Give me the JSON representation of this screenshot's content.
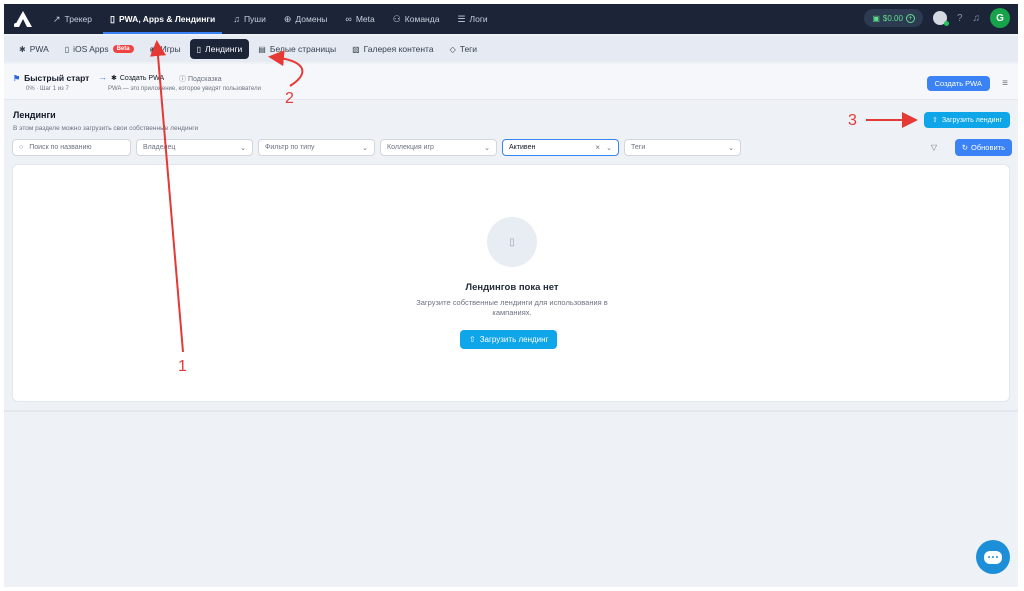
{
  "topnav": {
    "items": [
      {
        "label": "Трекер",
        "icon": "chart-icon"
      },
      {
        "label": "PWA, Apps & Лендинги",
        "icon": "phone-icon",
        "active": true
      },
      {
        "label": "Пуши",
        "icon": "bell-icon"
      },
      {
        "label": "Домены",
        "icon": "globe-icon"
      },
      {
        "label": "Meta",
        "icon": "meta-icon"
      },
      {
        "label": "Команда",
        "icon": "team-icon"
      },
      {
        "label": "Логи",
        "icon": "list-icon"
      }
    ],
    "balance": "$0.00",
    "avatar_letter": "G"
  },
  "subnav": {
    "items": [
      {
        "label": "PWA",
        "icon": "android-icon"
      },
      {
        "label": "iOS Apps",
        "icon": "phone-icon",
        "badge": "Beta"
      },
      {
        "label": "Игры",
        "icon": "gamepad-icon"
      },
      {
        "label": "Лендинги",
        "icon": "phone-icon",
        "active": true
      },
      {
        "label": "Белые страницы",
        "icon": "page-icon"
      },
      {
        "label": "Галерея контента",
        "icon": "gallery-icon"
      },
      {
        "label": "Теги",
        "icon": "tag-icon"
      }
    ]
  },
  "quickstart": {
    "title": "Быстрый старт",
    "progress": "0% · Шаг 1 из 7",
    "step": "Создать PWA",
    "hint": "Подсказка",
    "description": "PWA — это приложение, которое увидят пользователи",
    "create_button": "Создать PWA"
  },
  "section": {
    "title": "Лендинги",
    "description": "В этом разделе можно загрузить свои собственные лендинги",
    "upload_button": "Загрузить лендинг"
  },
  "filters": {
    "search_placeholder": "Поиск по названию",
    "owner": "Владелец",
    "type": "Фильтр по типу",
    "collection": "Коллекция игр",
    "status": "Активен",
    "tags": "Теги",
    "refresh_button": "Обновить"
  },
  "empty": {
    "title": "Лендингов пока нет",
    "description": "Загрузите собственные лендинги для использования в кампаниях.",
    "upload_button": "Загрузить лендинг"
  },
  "annotations": [
    "1",
    "2",
    "3"
  ],
  "colors": {
    "nav_bg": "#1c2538",
    "accent": "#3b82f6",
    "upload": "#0ea5e9",
    "annotation": "#e53935"
  }
}
